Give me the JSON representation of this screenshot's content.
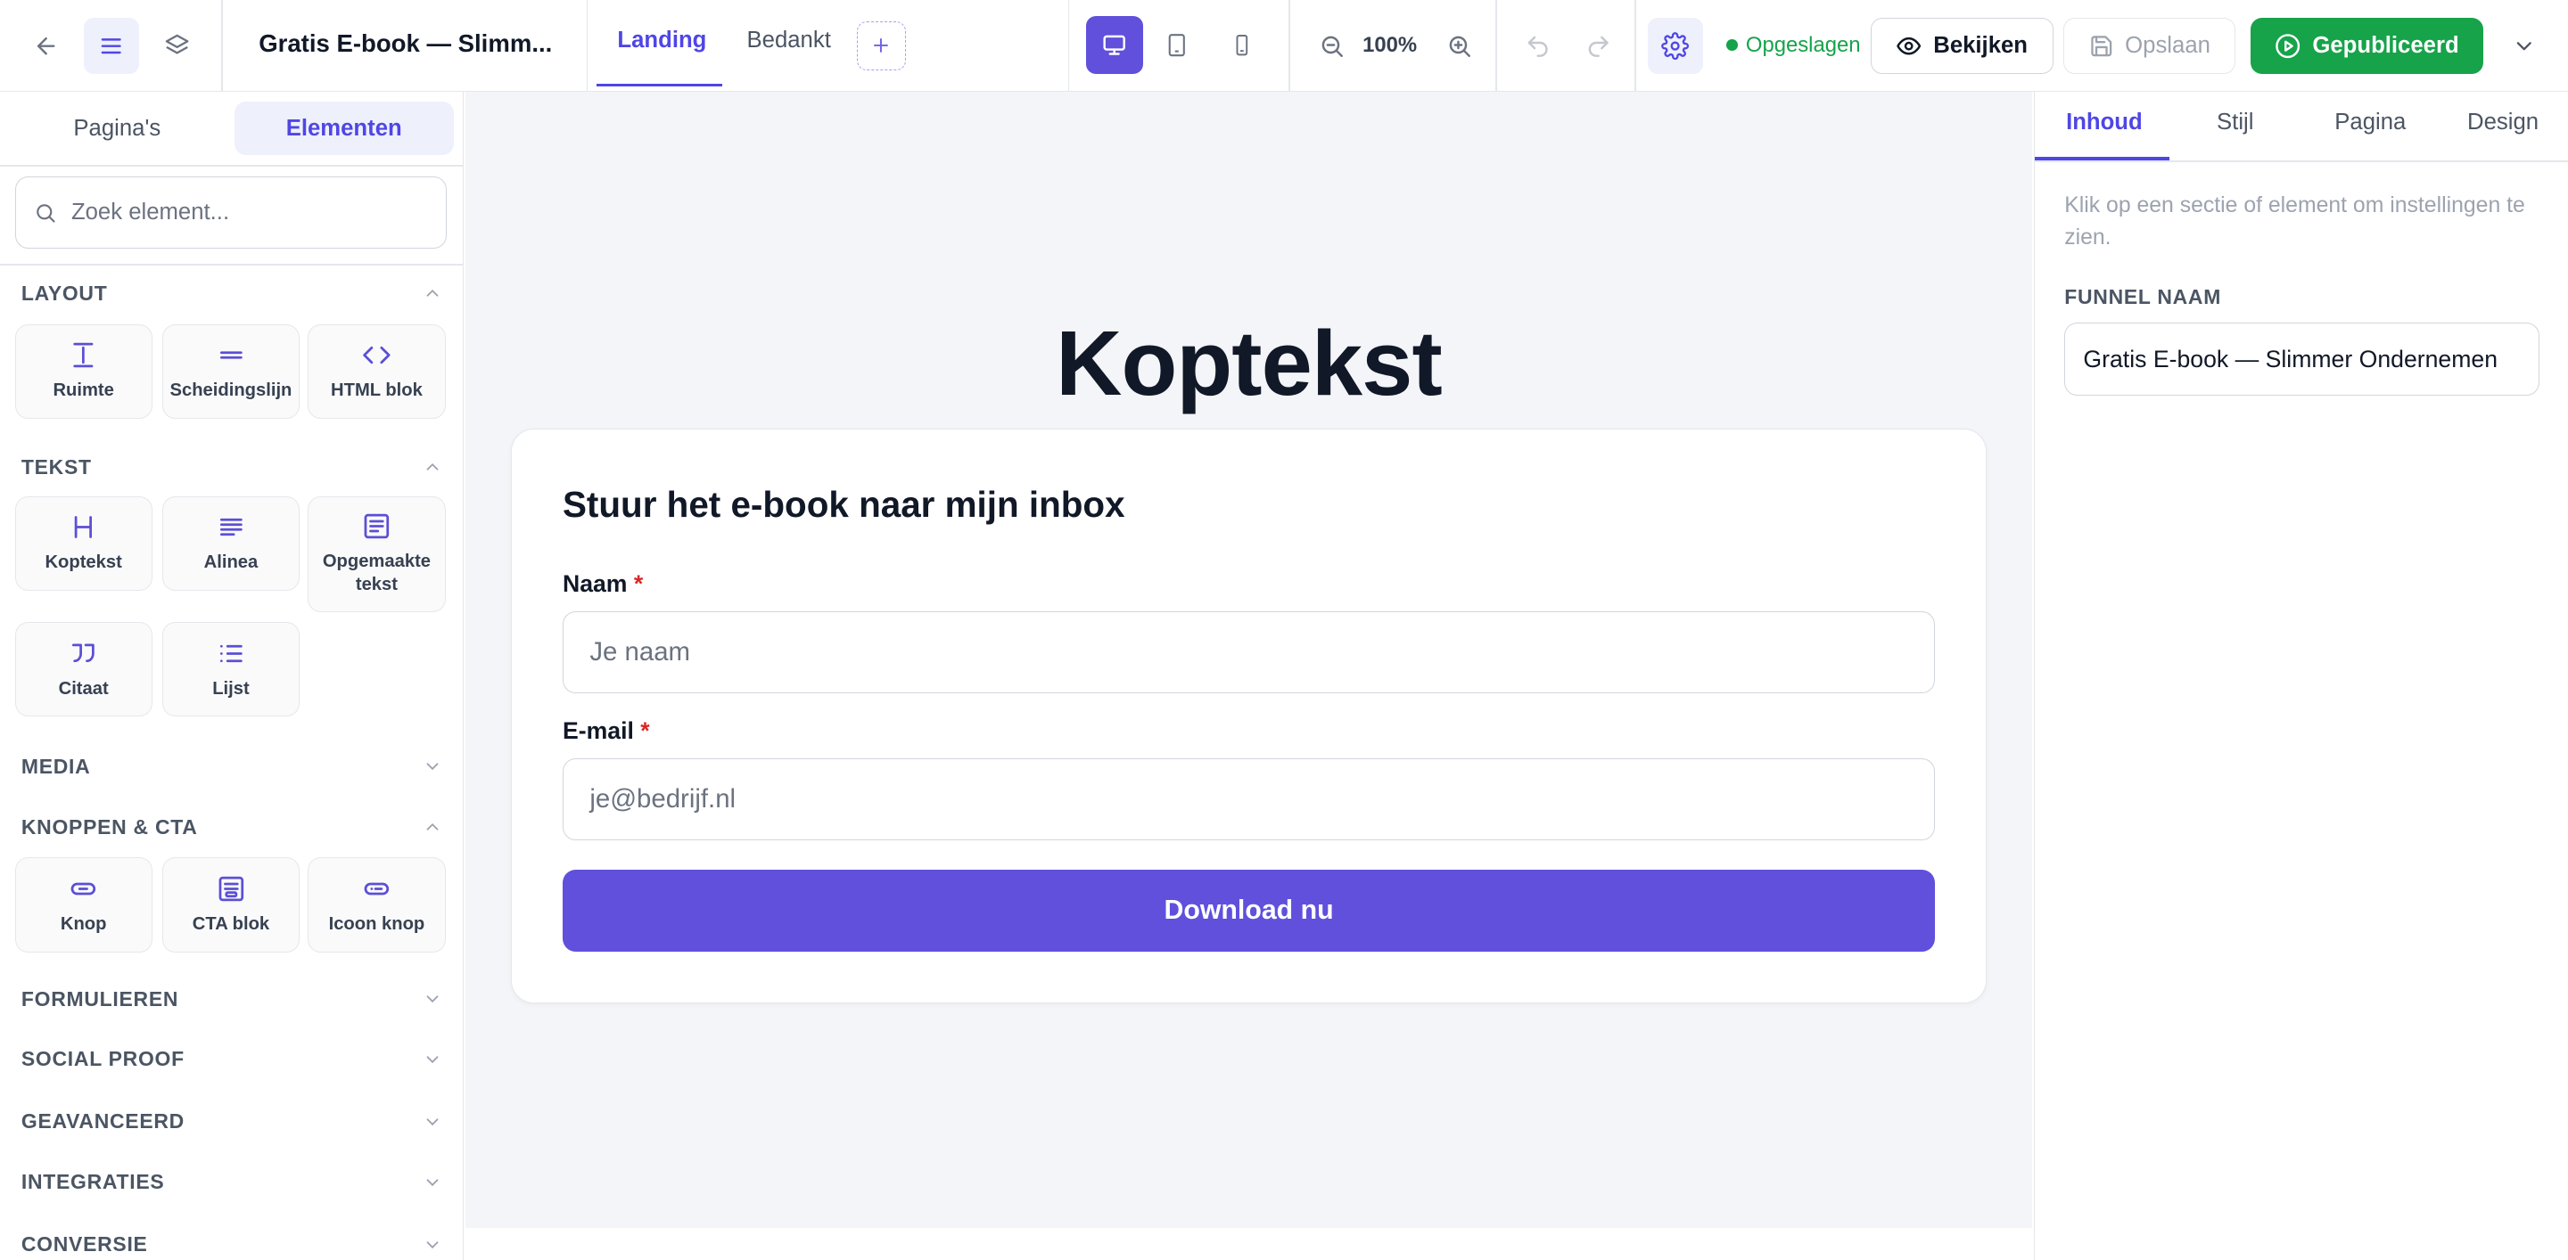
{
  "app": {
    "document_title": "Gratis E-book — Slimm...",
    "page_tabs": [
      {
        "label": "Landing",
        "active": true
      },
      {
        "label": "Bedankt",
        "active": false
      }
    ],
    "zoom": "100%",
    "save_status": "Opgeslagen",
    "buttons": {
      "preview": "Bekijken",
      "save": "Opslaan",
      "published": "Gepubliceerd"
    },
    "accent_color": "#6050dc",
    "published_color": "#16a34a"
  },
  "sidebar": {
    "tabs": [
      {
        "label": "Pagina's",
        "active": false
      },
      {
        "label": "Elementen",
        "active": true
      }
    ],
    "search_placeholder": "Zoek element...",
    "sections": [
      {
        "title": "LAYOUT",
        "expanded": true,
        "items": [
          {
            "label": "Ruimte",
            "icon": "vertical-space-icon"
          },
          {
            "label": "Scheidingslijn",
            "icon": "divider-icon"
          },
          {
            "label": "HTML blok",
            "icon": "code-icon"
          }
        ]
      },
      {
        "title": "TEKST",
        "expanded": true,
        "items": [
          {
            "label": "Koptekst",
            "icon": "heading-icon"
          },
          {
            "label": "Alinea",
            "icon": "paragraph-icon"
          },
          {
            "label": "Opgemaakte tekst",
            "icon": "rich-text-icon"
          },
          {
            "label": "Citaat",
            "icon": "quote-icon"
          },
          {
            "label": "Lijst",
            "icon": "list-icon"
          }
        ]
      },
      {
        "title": "MEDIA",
        "expanded": false,
        "items": []
      },
      {
        "title": "KNOPPEN & CTA",
        "expanded": true,
        "items": [
          {
            "label": "Knop",
            "icon": "button-icon"
          },
          {
            "label": "CTA blok",
            "icon": "cta-block-icon"
          },
          {
            "label": "Icoon knop",
            "icon": "icon-button-icon"
          }
        ]
      },
      {
        "title": "FORMULIEREN",
        "expanded": false,
        "items": []
      },
      {
        "title": "SOCIAL PROOF",
        "expanded": false,
        "items": []
      },
      {
        "title": "GEAVANCEERD",
        "expanded": false,
        "items": []
      },
      {
        "title": "INTEGRATIES",
        "expanded": false,
        "items": []
      },
      {
        "title": "CONVERSIE",
        "expanded": false,
        "items": []
      }
    ]
  },
  "canvas": {
    "heading": "Koptekst",
    "form": {
      "title": "Stuur het e-book naar mijn inbox",
      "fields": [
        {
          "label": "Naam",
          "required_mark": "*",
          "placeholder": "Je naam"
        },
        {
          "label": "E-mail",
          "required_mark": "*",
          "placeholder": "je@bedrijf.nl"
        }
      ],
      "submit_label": "Download nu"
    }
  },
  "inspector": {
    "tabs": [
      {
        "label": "Inhoud",
        "active": true
      },
      {
        "label": "Stijl",
        "active": false
      },
      {
        "label": "Pagina",
        "active": false
      },
      {
        "label": "Design",
        "active": false
      }
    ],
    "hint": "Klik op een sectie of element om instellingen te zien.",
    "funnel_name_label": "FUNNEL NAAM",
    "funnel_name_value": "Gratis E-book — Slimmer Ondernemen"
  }
}
